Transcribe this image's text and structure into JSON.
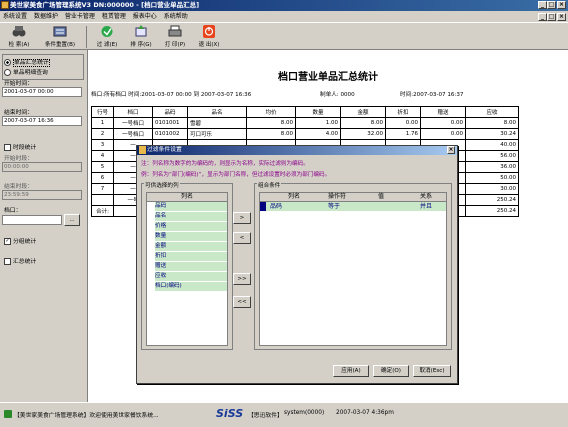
{
  "window": {
    "title": "美世家美食广场管理系统V3 DN:000000 - [档口营业单品汇总]"
  },
  "menu": [
    "系统设置",
    "数据维护",
    "营业卡管理",
    "租赁管理",
    "报表中心",
    "系统帮助"
  ],
  "toolbar": [
    {
      "label": "检 索(A)",
      "icon": "binoculars-icon"
    },
    {
      "label": "条件重置(B)",
      "icon": "condition-reset-icon"
    },
    {
      "label": "过 滤(E)",
      "icon": "filter-icon"
    },
    {
      "label": "排 序(G)",
      "icon": "sort-icon"
    },
    {
      "label": "打 印(P)",
      "icon": "printer-icon"
    },
    {
      "label": "退 出(X)",
      "icon": "exit-icon"
    }
  ],
  "left": {
    "opt1": "单品汇总统计",
    "opt2": "单品明细查询",
    "start_time_label": "开始时间：",
    "start_time": "2001-03-07 00:00",
    "end_time_label": "结束时间：",
    "end_time": "2007-03-07 16:36",
    "period_stats": "时段统计",
    "start_period_label": "开始时段：",
    "start_period": "00:00:00",
    "end_period_label": "结束时段：",
    "end_period": "23:59:59",
    "stall_label": "档口：",
    "stall_btn": "...",
    "group_stats": "分组统计",
    "summary_stats": "汇总统计"
  },
  "report": {
    "title": "档口营业单品汇总统计",
    "info": "档口:所有档口     时间:2001-03-07 00:00 到 2007-03-07 16:36",
    "maker": "制单人: 0000",
    "time": "时间:2007-03-07 16:37",
    "headers": [
      "行号",
      "档口",
      "品码",
      "品名",
      "均价",
      "数量",
      "金额",
      "折扣",
      "赠送",
      "应收"
    ],
    "rows": [
      [
        "1",
        "一号档口",
        "0101001",
        "雪碧",
        "8.00",
        "1.00",
        "8.00",
        "0.00",
        "0.00",
        "8.00"
      ],
      [
        "2",
        "一号档口",
        "0101002",
        "可口可乐",
        "8.00",
        "4.00",
        "32.00",
        "1.76",
        "0.00",
        "30.24"
      ],
      [
        "3",
        "一",
        "",
        "",
        "",
        "",
        "",
        "",
        "",
        "40.00"
      ],
      [
        "4",
        "一",
        "",
        "",
        "",
        "",
        "",
        "",
        "",
        "56.00"
      ],
      [
        "5",
        "一",
        "",
        "",
        "",
        "",
        "",
        "",
        "",
        "36.00"
      ],
      [
        "6",
        "一",
        "",
        "",
        "",
        "",
        "",
        "",
        "",
        "50.00"
      ],
      [
        "7",
        "一",
        "",
        "",
        "",
        "",
        "",
        "",
        "",
        "30.00"
      ],
      [
        "",
        "一号",
        "",
        "",
        "",
        "",
        "",
        "",
        "",
        "250.24"
      ],
      [
        "合计:",
        "",
        "",
        "",
        "",
        "",
        "",
        "",
        "",
        "250.24"
      ]
    ]
  },
  "dialog": {
    "title": "过滤条件设置",
    "note1": "注：列名称为数字的为编码的，则显示为名称，实际过滤则为编码。",
    "note2": "例：列名为“部门(编码)”，显示为部门名称，但过滤设置时必须为部门编码。",
    "left_title": "可供选择的列",
    "left_header": "列名",
    "columns": [
      "品码",
      "品名",
      "价格",
      "数量",
      "金额",
      "折扣",
      "赠送",
      "应收",
      "档口(编码)"
    ],
    "right_title": "组合条件",
    "right_headers": [
      "列名",
      "操作符",
      "值",
      "关系"
    ],
    "cond_row": [
      "品码",
      "等于",
      "",
      "并且"
    ],
    "btn_add": ">",
    "btn_remove": "<",
    "btn_add_all": ">>",
    "btn_remove_all": "<<",
    "apply": "应用(A)",
    "ok": "确定(O)",
    "cancel": "取消(Esc)"
  },
  "status": {
    "left": "【美世家美食广场管理系统】欢迎使用美世家餐饮系统...",
    "brand": "SiSS",
    "company": "【思迅软件】",
    "user": "system(0000)",
    "time": "2007-03-07 4:36pm"
  }
}
